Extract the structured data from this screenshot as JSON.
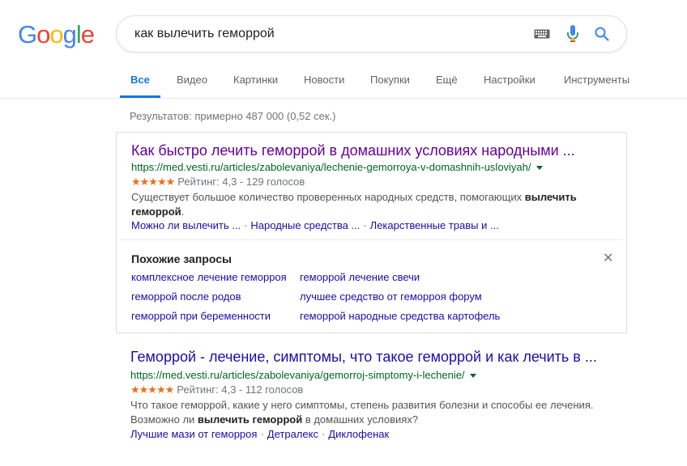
{
  "logo": {
    "letters": [
      "G",
      "o",
      "o",
      "g",
      "l",
      "e"
    ],
    "colors": [
      "#4285F4",
      "#EA4335",
      "#FBBC05",
      "#4285F4",
      "#34A853",
      "#EA4335"
    ]
  },
  "search": {
    "query": "как вылечить геморрой",
    "icons": [
      "keyboard-icon",
      "mic-icon",
      "search-icon"
    ]
  },
  "tabs": [
    {
      "label": "Все",
      "active": true
    },
    {
      "label": "Видео"
    },
    {
      "label": "Картинки"
    },
    {
      "label": "Новости"
    },
    {
      "label": "Покупки"
    },
    {
      "label": "Ещё"
    },
    {
      "label": "Настройки"
    },
    {
      "label": "Инструменты"
    }
  ],
  "stats": "Результатов: примерно 487 000 (0,52 сек.)",
  "results": [
    {
      "title": "Как быстро лечить геморрой в домашних условиях народными ...",
      "url": "https://med.vesti.ru/articles/zabolevaniya/lechenie-gemorroya-v-domashnih-usloviyah/",
      "stars": "★★★★★",
      "rating": "Рейтинг: 4,3 - 129 голосов",
      "snippet_pre": "Существует большое количество проверенных народных средств, помогающих ",
      "snippet_bold": "вылечить геморрой",
      "snippet_post": ".",
      "sitelinks": [
        "Можно ли вылечить ...",
        "Народные средства ...",
        "Лекарственные травы и ..."
      ]
    },
    {
      "title": "Геморрой - лечение, симптомы, что такое геморрой и как лечить в ...",
      "url": "https://med.vesti.ru/articles/zabolevaniya/gemorroj-simptomy-i-lechenie/",
      "stars": "★★★★★",
      "rating": "Рейтинг: 4,3 - 112 голосов",
      "snippet_line1": "Что такое геморрой, какие у него симптомы, степень развития болезни и способы ее лечения.",
      "snippet_pre": "Возможно ли ",
      "snippet_bold": "вылечить геморрой",
      "snippet_post": " в домашних условиях?",
      "sitelinks": [
        "Лучшие мази от геморроя",
        "Детралекс",
        "Диклофенак"
      ]
    }
  ],
  "related": {
    "title": "Похожие запросы",
    "left": [
      "комплексное лечение геморроя",
      "геморрой после родов",
      "геморрой при беременности"
    ],
    "right": [
      "геморрой лечение свечи",
      "лучшее средство от геморроя форум",
      "геморрой народные средства картофель"
    ]
  },
  "colors": {
    "link_visited": "#660099",
    "link": "#1a0dab",
    "url": "#006621",
    "accent": "#1a73e8",
    "star": "#e7711b"
  }
}
